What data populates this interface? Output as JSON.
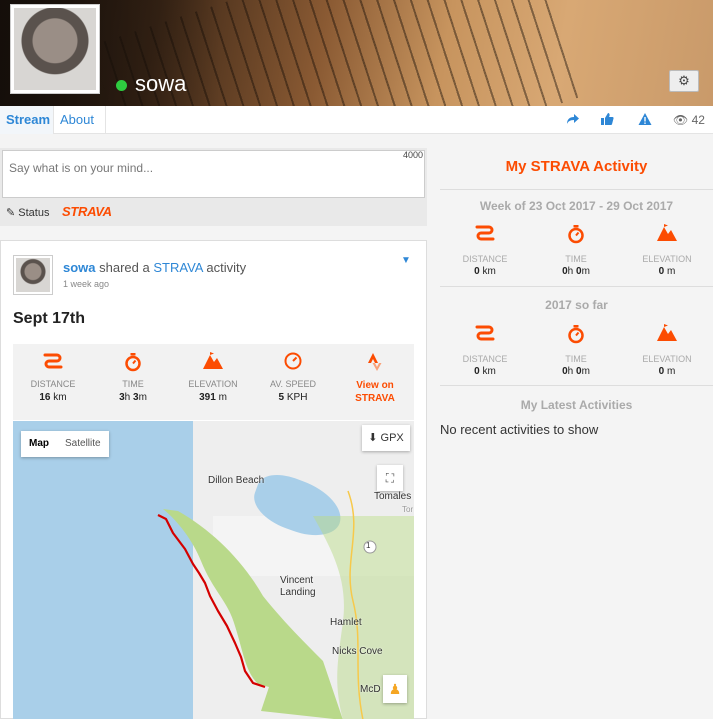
{
  "profile": {
    "username": "sowa",
    "online": true
  },
  "tabs": [
    {
      "label": "Stream"
    },
    {
      "label": "About"
    }
  ],
  "header_actions": {
    "views_count": "42"
  },
  "compose": {
    "placeholder": "Say what is on your mind...",
    "char_limit": "4000",
    "status_label": "Status",
    "strava_label": "STRAVA"
  },
  "post": {
    "author": "sowa",
    "shared_text": "shared a",
    "strava_link": "STRAVA",
    "activity_text": "activity",
    "time_ago": "1 week ago",
    "title": "Sept 17th",
    "stats": [
      {
        "label": "DISTANCE",
        "value": "16",
        "unit": "km",
        "icon": "distance-icon"
      },
      {
        "label": "TIME",
        "value_h": "3",
        "value_m": "3",
        "icon": "stopwatch-icon"
      },
      {
        "label": "ELEVATION",
        "value": "391",
        "unit": "m",
        "icon": "elevation-icon"
      },
      {
        "label": "AV. SPEED",
        "value": "5",
        "unit": "KPH",
        "icon": "speedometer-icon"
      }
    ],
    "view_on_strava": "View on STRAVA",
    "map": {
      "btn_map": "Map",
      "btn_satellite": "Satellite",
      "gpx_label": "GPX",
      "labels": [
        "Dillon Beach",
        "Tomales",
        "Tor",
        "1",
        "Vincent",
        "Landing",
        "Hamlet",
        "Nicks Cove",
        "McD"
      ]
    }
  },
  "sidebar": {
    "title": "My STRAVA Activity",
    "week_heading": "Week of 23 Oct 2017 - 29 Oct 2017",
    "year_heading": "2017 so far",
    "latest_heading": "My Latest Activities",
    "no_recent": "No recent activities to show",
    "week_stats": [
      {
        "label": "DISTANCE",
        "value": "0",
        "unit": "km"
      },
      {
        "label": "TIME",
        "value_h": "0",
        "value_m": "0"
      },
      {
        "label": "ELEVATION",
        "value": "0",
        "unit": "m"
      }
    ],
    "year_stats": [
      {
        "label": "DISTANCE",
        "value": "0",
        "unit": "km"
      },
      {
        "label": "TIME",
        "value_h": "0",
        "value_m": "0"
      },
      {
        "label": "ELEVATION",
        "value": "0",
        "unit": "m"
      }
    ]
  },
  "colors": {
    "strava_orange": "#fc4c02",
    "link_blue": "#2e87d6",
    "online_green": "#2ecc40"
  }
}
